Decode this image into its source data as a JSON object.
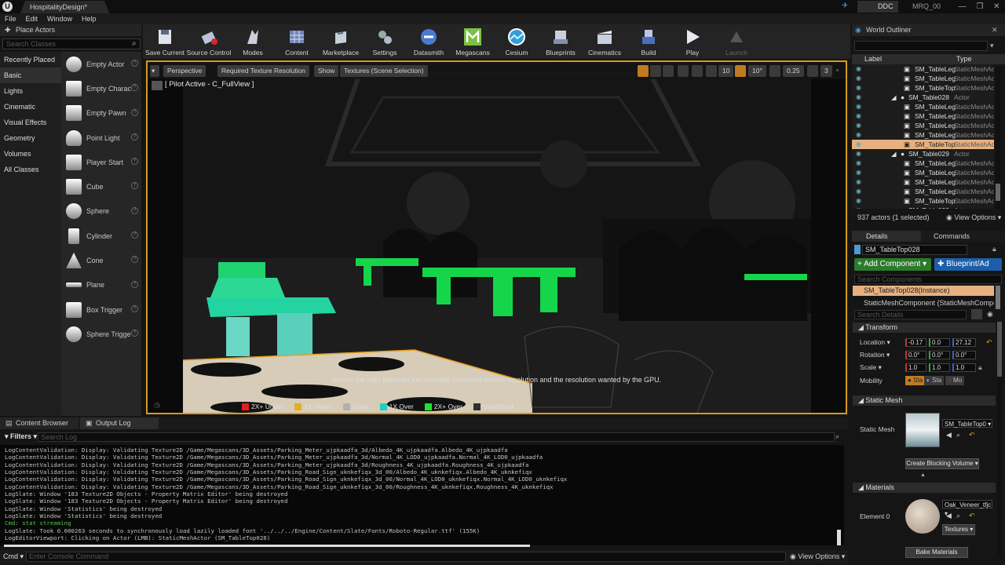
{
  "titlebar": {
    "logo": "U",
    "doc_tab": "HospitalityDesign*",
    "ddc": "DDC",
    "mrq": "MRQ_00",
    "minimize": "—",
    "maximize": "❐",
    "close": "✕"
  },
  "menubar": [
    "File",
    "Edit",
    "Window",
    "Help"
  ],
  "place_actors": {
    "tab": "Place Actors",
    "search_placeholder": "Search Classes",
    "categories": [
      "Recently Placed",
      "Basic",
      "Lights",
      "Cinematic",
      "Visual Effects",
      "Geometry",
      "Volumes",
      "All Classes"
    ],
    "items": [
      "Empty Actor",
      "Empty Charac",
      "Empty Pawn",
      "Point Light",
      "Player Start",
      "Cube",
      "Sphere",
      "Cylinder",
      "Cone",
      "Plane",
      "Box Trigger",
      "Sphere Trigge"
    ]
  },
  "toolbar": [
    {
      "label": "Save Current",
      "icon": "save-icon"
    },
    {
      "label": "Source Control",
      "icon": "source-control-icon"
    },
    {
      "label": "Modes",
      "icon": "modes-icon"
    },
    {
      "label": "Content",
      "icon": "content-icon"
    },
    {
      "label": "Marketplace",
      "icon": "marketplace-icon"
    },
    {
      "label": "Settings",
      "icon": "settings-icon"
    },
    {
      "label": "Datasmith",
      "icon": "datasmith-icon"
    },
    {
      "label": "Megascans",
      "icon": "megascans-icon"
    },
    {
      "label": "Cesium",
      "icon": "cesium-icon"
    },
    {
      "label": "Blueprints",
      "icon": "blueprints-icon"
    },
    {
      "label": "Cinematics",
      "icon": "cinematics-icon"
    },
    {
      "label": "Build",
      "icon": "build-icon"
    },
    {
      "label": "Play",
      "icon": "play-icon"
    },
    {
      "label": "Launch",
      "icon": "launch-icon"
    }
  ],
  "viewport": {
    "perspective": "Perspective",
    "view_mode": "Required Texture Resolution",
    "show": "Show",
    "textures": "Textures (Scene Selection)",
    "grid_snap": "10",
    "rot_snap": "10°",
    "scale_snap": "0.25",
    "camera_speed": "3",
    "pilot": "[ Pilot Active - C_FullView ]",
    "tooltip": "Shows the ratio between the currently streamed texture resolution and the resolution wanted by the GPU.",
    "legend": [
      {
        "label": "2X+ Under",
        "color": "#e02020"
      },
      {
        "label": "1X Under",
        "color": "#e0b020"
      },
      {
        "label": "Good",
        "color": "#b0b0b0"
      },
      {
        "label": "1X Over",
        "color": "#20d0c0"
      },
      {
        "label": "2X+ Over",
        "color": "#20e030"
      },
      {
        "label": "Undefined",
        "color": "#303030"
      }
    ]
  },
  "world_outliner": {
    "tab": "World Outliner",
    "col_label": "Label",
    "col_type": "Type",
    "rows": [
      {
        "label": "SM_TableLeg",
        "type": "StaticMeshAc",
        "indent": 2,
        "sel": false
      },
      {
        "label": "SM_TableLeg",
        "type": "StaticMeshAc",
        "indent": 2,
        "sel": false
      },
      {
        "label": "SM_TableTop",
        "type": "StaticMeshAc",
        "indent": 2,
        "sel": false
      },
      {
        "label": "SM_Table028",
        "type": "Actor",
        "indent": 1,
        "sel": false
      },
      {
        "label": "SM_TableLeg",
        "type": "StaticMeshAc",
        "indent": 2,
        "sel": false
      },
      {
        "label": "SM_TableLeg",
        "type": "StaticMeshAc",
        "indent": 2,
        "sel": false
      },
      {
        "label": "SM_TableLeg",
        "type": "StaticMeshAc",
        "indent": 2,
        "sel": false
      },
      {
        "label": "SM_TableLeg",
        "type": "StaticMeshAc",
        "indent": 2,
        "sel": false
      },
      {
        "label": "SM_TableTop",
        "type": "StaticMeshAc",
        "indent": 2,
        "sel": true
      },
      {
        "label": "SM_Table029",
        "type": "Actor",
        "indent": 1,
        "sel": false
      },
      {
        "label": "SM_TableLeg",
        "type": "StaticMeshAc",
        "indent": 2,
        "sel": false
      },
      {
        "label": "SM_TableLeg",
        "type": "StaticMeshAc",
        "indent": 2,
        "sel": false
      },
      {
        "label": "SM_TableLeg",
        "type": "StaticMeshAc",
        "indent": 2,
        "sel": false
      },
      {
        "label": "SM_TableLeg",
        "type": "StaticMeshAc",
        "indent": 2,
        "sel": false
      },
      {
        "label": "SM_TableTop",
        "type": "StaticMeshAc",
        "indent": 2,
        "sel": false
      },
      {
        "label": "SM_Table030",
        "type": "Actor",
        "indent": 1,
        "sel": false
      }
    ],
    "status": "937 actors (1 selected)",
    "view_options": "View Options"
  },
  "details": {
    "tab_details": "Details",
    "tab_commands": "Commands",
    "name": "SM_TableTop028",
    "add_component": "+ Add Component ▾",
    "blueprint_add": "Blueprint/Ad",
    "search_components": "Search Components",
    "instance": "SM_TableTop028(Instance)",
    "static_mesh_component": "StaticMeshComponent (StaticMeshCompon",
    "search_details": "Search Details",
    "transform": "Transform",
    "location_label": "Location ▾",
    "location": [
      "-0.17",
      "0.0",
      "27.12"
    ],
    "rotation_label": "Rotation ▾",
    "rotation": [
      "0.0°",
      "0.0°",
      "0.0°"
    ],
    "scale_label": "Scale ▾",
    "scale": [
      "1.0",
      "1.0",
      "1.0"
    ],
    "mobility_label": "Mobility",
    "mobility": [
      "Sta",
      "Sta",
      "Mo"
    ],
    "static_mesh_section": "Static Mesh",
    "static_mesh_label": "Static Mesh",
    "static_mesh_value": "SM_TableTop0",
    "create_blocking": "Create Blocking Volume ▾",
    "materials_section": "Materials",
    "element0_label": "Element 0",
    "material_value": "Oak_Veneer_tfjc",
    "textures": "Textures ▾",
    "bake_materials": "Bake Materials"
  },
  "bottom": {
    "content_browser": "Content Browser",
    "output_log": "Output Log",
    "filters": "▾ Filters ▾",
    "search_log": "Search Log",
    "log": [
      "LogContentValidation: Display: Validating Texture2D /Game/Megascans/3D_Assets/Parking_Meter_ujpkaadfa_3d/Albedo_4K_ujpkaadfa.Albedo_4K_ujpkaadfa",
      "LogContentValidation: Display: Validating Texture2D /Game/Megascans/3D_Assets/Parking_Meter_ujpkaadfa_3d/Normal_4K_LOD0_ujpkaadfa.Normal_4K_LOD0_ujpkaadfa",
      "LogContentValidation: Display: Validating Texture2D /Game/Megascans/3D_Assets/Parking_Meter_ujpkaadfa_3d/Roughness_4K_ujpkaadfa.Roughness_4K_ujpkaadfa",
      "LogContentValidation: Display: Validating Texture2D /Game/Megascans/3D_Assets/Parking_Road_Sign_uknkefiqx_3d_00/Albedo_4K_uknkefiqx.Albedo_4K_uknkefiqx",
      "LogContentValidation: Display: Validating Texture2D /Game/Megascans/3D_Assets/Parking_Road_Sign_uknkefiqx_3d_00/Normal_4K_LOD0_uknkefiqx.Normal_4K_LOD0_uknkefiqx",
      "LogContentValidation: Display: Validating Texture2D /Game/Megascans/3D_Assets/Parking_Road_Sign_uknkefiqx_3d_00/Roughness_4K_uknkefiqx.Roughness_4K_uknkefiqx",
      "LogSlate: Window '183 Texture2D Objects - Property Matrix Editor' being destroyed",
      "LogSlate: Window '183 Texture2D Objects - Property Matrix Editor' being destroyed",
      "LogSlate: Window 'Statistics' being destroyed",
      "LogSlate: Window 'Statistics' being destroyed",
      "Cmd: stat streaming",
      "LogSlate: Took 0.000263 seconds to synchronously load lazily loaded font '../../../Engine/Content/Slate/Fonts/Roboto-Regular.ttf' (155K)",
      "LogEditorViewport: Clicking on Actor (LMB): StaticMeshActor (SM_TableTop028)"
    ],
    "cmd_label": "Cmd ▾",
    "cmd_placeholder": "Enter Console Command",
    "view_options": "View Options ▾"
  }
}
